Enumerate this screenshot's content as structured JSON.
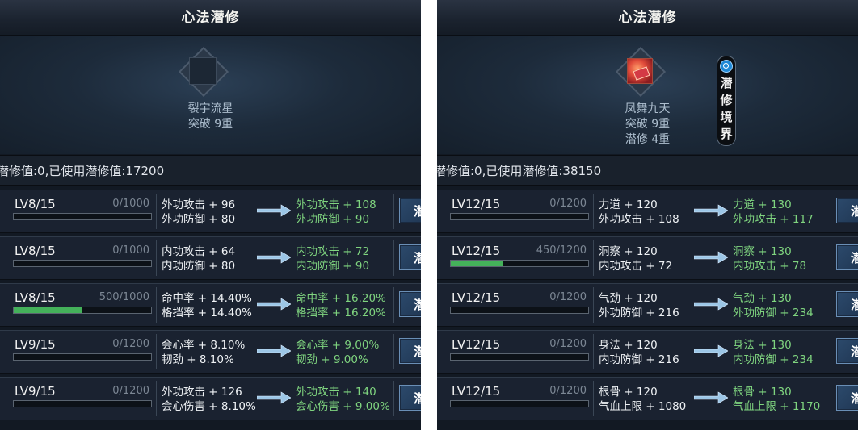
{
  "panels": [
    {
      "title": "心法潜修",
      "skill": {
        "name": "裂宇流星",
        "line2": "突破 9重",
        "line3": "",
        "icon": "empty-slot-icon"
      },
      "points": "潜修值:0,已使用潜修值:17200",
      "rows": [
        {
          "level": "LV8/15",
          "cap": "0/1000",
          "progress": 0,
          "s1": "外功攻击 + 96",
          "s2": "外功防御 + 80",
          "n1": "外功攻击 + 108",
          "n2": "外功防御 + 90",
          "btn": "潜"
        },
        {
          "level": "LV8/15",
          "cap": "0/1000",
          "progress": 0,
          "s1": "内功攻击 + 64",
          "s2": "内功防御 + 80",
          "n1": "内功攻击 + 72",
          "n2": "内功防御 + 90",
          "btn": "潜"
        },
        {
          "level": "LV8/15",
          "cap": "500/1000",
          "progress": 0.5,
          "s1": "命中率 + 14.40%",
          "s2": "格挡率 + 14.40%",
          "n1": "命中率 + 16.20%",
          "n2": "格挡率 + 16.20%",
          "btn": "潜"
        },
        {
          "level": "LV9/15",
          "cap": "0/1200",
          "progress": 0,
          "s1": "会心率 + 8.10%",
          "s2": "韧劲 + 8.10%",
          "n1": "会心率 + 9.00%",
          "n2": "韧劲 + 9.00%",
          "btn": "潜"
        },
        {
          "level": "LV9/15",
          "cap": "0/1200",
          "progress": 0,
          "s1": "外功攻击 + 126",
          "s2": "会心伤害 + 8.10%",
          "n1": "外功攻击 + 140",
          "n2": "会心伤害 + 9.00%",
          "btn": "潜"
        }
      ]
    },
    {
      "title": "心法潜修",
      "skill": {
        "name": "凤舞九天",
        "line2": "突破 9重",
        "line3": "潜修 4重",
        "icon": "phoenix-skill-icon"
      },
      "realm_button": [
        "潜",
        "修",
        "境",
        "界"
      ],
      "points": "潜修值:0,已使用潜修值:38150",
      "rows": [
        {
          "level": "LV12/15",
          "cap": "0/1200",
          "progress": 0,
          "s1": "力道 + 120",
          "s2": "外功攻击 + 108",
          "n1": "力道 + 130",
          "n2": "外功攻击 + 117",
          "btn": "潜"
        },
        {
          "level": "LV12/15",
          "cap": "450/1200",
          "progress": 0.375,
          "s1": "洞察 + 120",
          "s2": "内功攻击 + 72",
          "n1": "洞察 + 130",
          "n2": "内功攻击 + 78",
          "btn": "潜"
        },
        {
          "level": "LV12/15",
          "cap": "0/1200",
          "progress": 0,
          "s1": "气劲 + 120",
          "s2": "外功防御 + 216",
          "n1": "气劲 + 130",
          "n2": "外功防御 + 234",
          "btn": "潜"
        },
        {
          "level": "LV12/15",
          "cap": "0/1200",
          "progress": 0,
          "s1": "身法 + 120",
          "s2": "内功防御 + 216",
          "n1": "身法 + 130",
          "n2": "内功防御 + 234",
          "btn": "潜"
        },
        {
          "level": "LV12/15",
          "cap": "0/1200",
          "progress": 0,
          "s1": "根骨 + 120",
          "s2": "气血上限 + 1080",
          "n1": "根骨 + 130",
          "n2": "气血上限 + 1170",
          "btn": "潜"
        }
      ]
    }
  ],
  "colors": {
    "upgrade_text": "#7fd47f",
    "progress_fill": "#44b15a",
    "panel_bg": "#121923"
  }
}
